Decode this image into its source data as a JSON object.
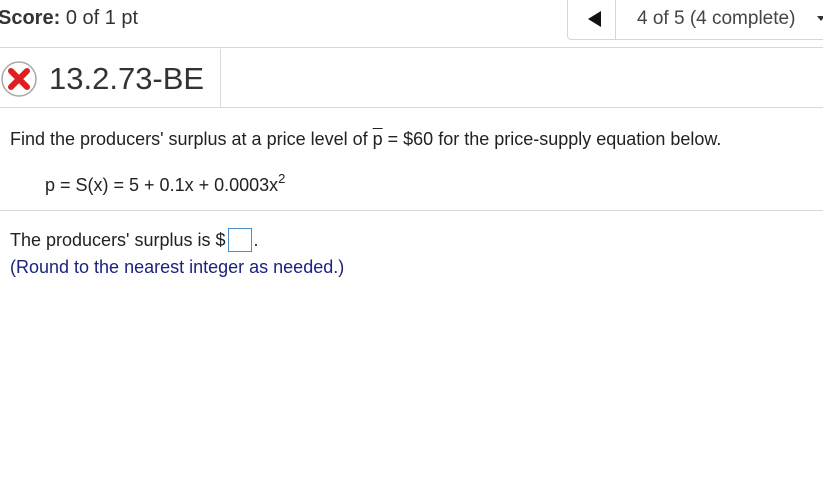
{
  "header": {
    "score_label": "Score:",
    "score_value": "0 of 1 pt",
    "nav": {
      "progress": "4 of 5 (4 complete)",
      "prev_icon": "triangle-left-icon",
      "dropdown_icon": "caret-down-icon"
    }
  },
  "question": {
    "status_icon": "incorrect-x-icon",
    "id": "13.2.73-BE",
    "prompt_before": "Find the producers' surplus at a price level of ",
    "price_symbol": "p",
    "prompt_after": " = $60 for the price-supply equation below.",
    "equation": "p = S(x) = 5 + 0.1x + 0.0003x",
    "equation_exponent": "2"
  },
  "answer": {
    "prefix": "The producers' surplus is $",
    "value": "",
    "suffix": ".",
    "hint": "(Round to the nearest integer as needed.)"
  },
  "colors": {
    "incorrect_red": "#e02020",
    "hint_blue": "#1a237e",
    "input_border": "#4f8fcf"
  }
}
